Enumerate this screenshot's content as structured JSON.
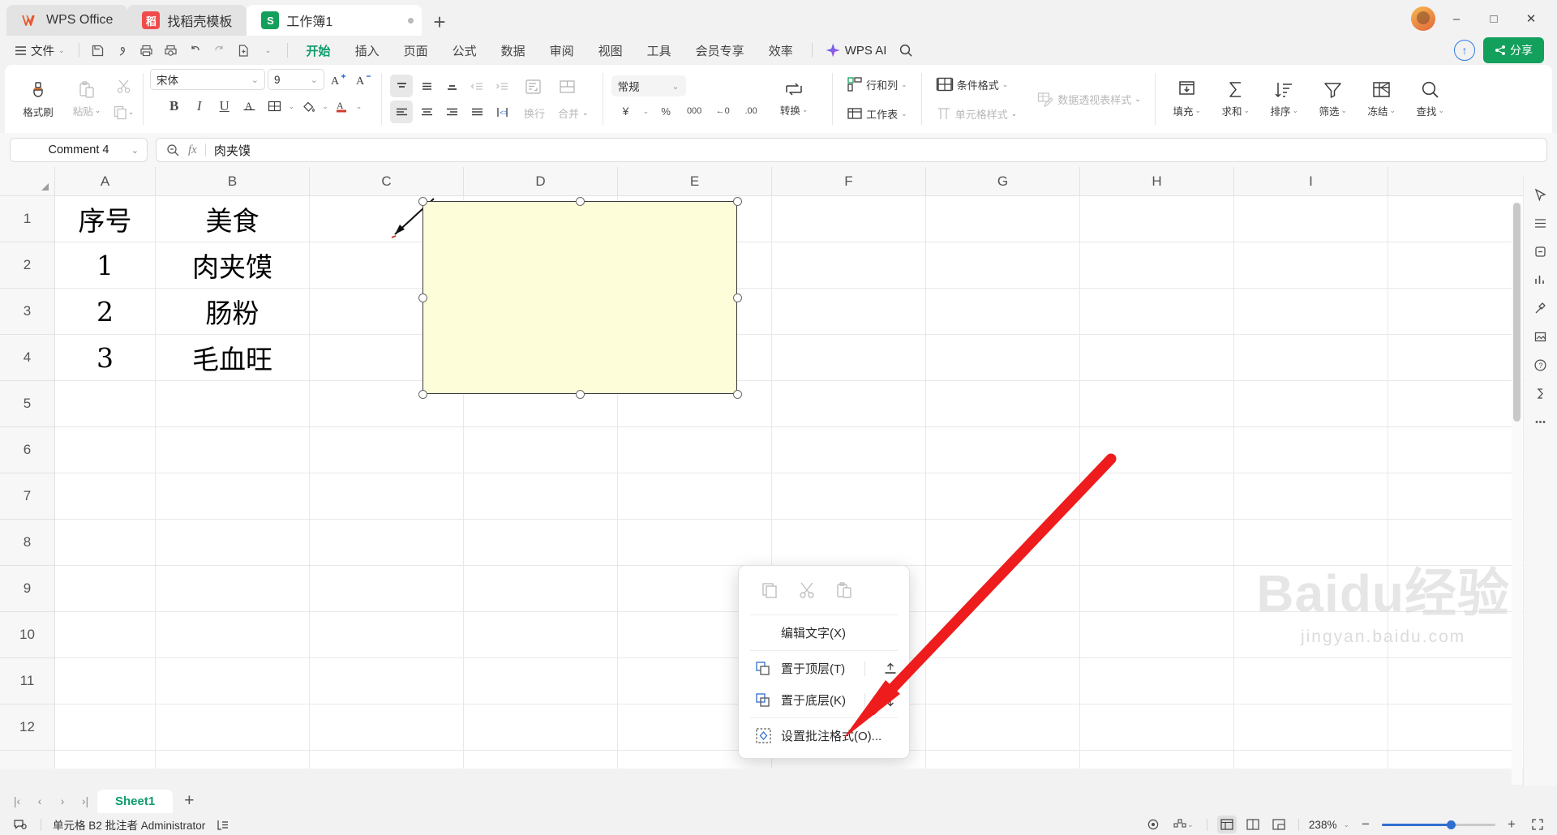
{
  "window": {
    "tabs": [
      {
        "label": "WPS Office",
        "icon": "wps-logo-icon",
        "state": "soft"
      },
      {
        "label": "找稻壳模板",
        "icon": "daoke-icon",
        "state": "soft"
      },
      {
        "label": "工作簿1",
        "icon": "sheet-icon",
        "state": "active"
      }
    ],
    "new_tab_label": "+",
    "minimize": "–",
    "maximize": "□",
    "close": "✕"
  },
  "menu": {
    "file_label": "文件",
    "quick_access": [
      "save-icon",
      "save-as-icon",
      "print-icon",
      "print-preview-icon",
      "undo-icon",
      "redo-icon",
      "new-icon",
      "more-icon"
    ],
    "ribbon_tabs": [
      {
        "label": "开始",
        "active": true
      },
      {
        "label": "插入",
        "active": false
      },
      {
        "label": "页面",
        "active": false
      },
      {
        "label": "公式",
        "active": false
      },
      {
        "label": "数据",
        "active": false
      },
      {
        "label": "审阅",
        "active": false
      },
      {
        "label": "视图",
        "active": false
      },
      {
        "label": "工具",
        "active": false
      },
      {
        "label": "会员专享",
        "active": false
      },
      {
        "label": "效率",
        "active": false
      }
    ],
    "ai_label": "WPS AI",
    "search_icon": "search-icon",
    "help_icon": "help-icon",
    "share_label": "分享"
  },
  "ribbon": {
    "format_painter": "格式刷",
    "paste": "粘贴",
    "copy_small": "copy-icon",
    "cut_small": "cut-icon",
    "font_name": "宋体",
    "font_size": "9",
    "grow_font": "A+",
    "shrink_font": "A-",
    "bold": "B",
    "italic": "I",
    "underline": "U",
    "strikethrough": "S",
    "border": "border-icon",
    "fill_color": "fill-color-icon",
    "font_color": "font-color-icon",
    "wrap_text": "换行",
    "merge_cells": "合并",
    "number_format": "常规",
    "currency": "¥",
    "percent": "%",
    "comma": "000",
    "inc_dec": "←0",
    "dec_dec": ".00",
    "convert": "转换",
    "rows_cols": "行和列",
    "worksheet": "工作表",
    "conditional_format": "条件格式",
    "cell_styles": "单元格样式",
    "pivot_style": "数据透视表样式",
    "pivot_icon": "pivot-table-icon",
    "fill": "填充",
    "sum": "求和",
    "sort": "排序",
    "filter": "筛选",
    "freeze": "冻结",
    "find": "查找"
  },
  "formula_bar": {
    "name_box_value": "Comment 4",
    "zoom_icon": "zoom-out-icon",
    "fx_label": "fx",
    "content": "肉夹馍"
  },
  "sheet": {
    "columns": [
      "A",
      "B",
      "C",
      "D",
      "E",
      "F",
      "G",
      "H",
      "I"
    ],
    "rows": [
      "1",
      "2",
      "3",
      "4",
      "5",
      "6",
      "7",
      "8",
      "9",
      "10",
      "11",
      "12"
    ],
    "cells": [
      {
        "col": "A",
        "row": "1",
        "value": "序号"
      },
      {
        "col": "B",
        "row": "1",
        "value": "美食"
      },
      {
        "col": "A",
        "row": "2",
        "value": "1"
      },
      {
        "col": "B",
        "row": "2",
        "value": "肉夹馍"
      },
      {
        "col": "A",
        "row": "3",
        "value": "2"
      },
      {
        "col": "B",
        "row": "3",
        "value": "肠粉"
      },
      {
        "col": "A",
        "row": "4",
        "value": "3"
      },
      {
        "col": "B",
        "row": "4",
        "value": "毛血旺"
      }
    ],
    "comment_box": {
      "fill": "#fdfdd9",
      "border": "#3a3a3a",
      "text": ""
    }
  },
  "context_menu": {
    "top_icons": [
      {
        "name": "copy-icon",
        "glyph": "copy"
      },
      {
        "name": "cut-icon",
        "glyph": "cut"
      },
      {
        "name": "paste-icon",
        "glyph": "paste"
      }
    ],
    "items": [
      {
        "label": "编辑文字(X)",
        "icon": null,
        "trailing": null
      },
      {
        "label": "置于顶层(T)",
        "icon": "bring-to-front-icon",
        "trailing": "bring-forward-icon"
      },
      {
        "label": "置于底层(K)",
        "icon": "send-to-back-icon",
        "trailing": "send-backward-icon"
      },
      {
        "label": "设置批注格式(O)...",
        "icon": "format-comment-icon",
        "trailing": null
      }
    ]
  },
  "right_rail": {
    "items": [
      "cursor-icon",
      "table-style-icon",
      "crop-icon",
      "chart-icon",
      "tools-icon",
      "image-icon",
      "help-circle-icon",
      "formula-fx-icon",
      "more-dots-icon"
    ]
  },
  "sheet_tabs": {
    "nav": [
      "first-sheet-icon",
      "prev-sheet-icon",
      "next-sheet-icon",
      "last-sheet-icon"
    ],
    "tabs": [
      {
        "label": "Sheet1",
        "active": true
      }
    ],
    "add_label": "+"
  },
  "status_bar": {
    "left_icon": "comment-status-icon",
    "text": "单元格 B2 批注者 Administrator",
    "note_icon": "note-list-icon",
    "eye_icon": "eye-icon",
    "layout_icon": "layout-icon",
    "views": [
      "normal-view-icon",
      "page-layout-icon",
      "page-break-icon"
    ],
    "active_view": 0,
    "zoom_value": "238%",
    "zoom_out": "−",
    "zoom_in": "+",
    "fullscreen_icon": "fullscreen-icon"
  },
  "watermark": {
    "big": "Baidu经验",
    "small": "jingyan.baidu.com"
  }
}
